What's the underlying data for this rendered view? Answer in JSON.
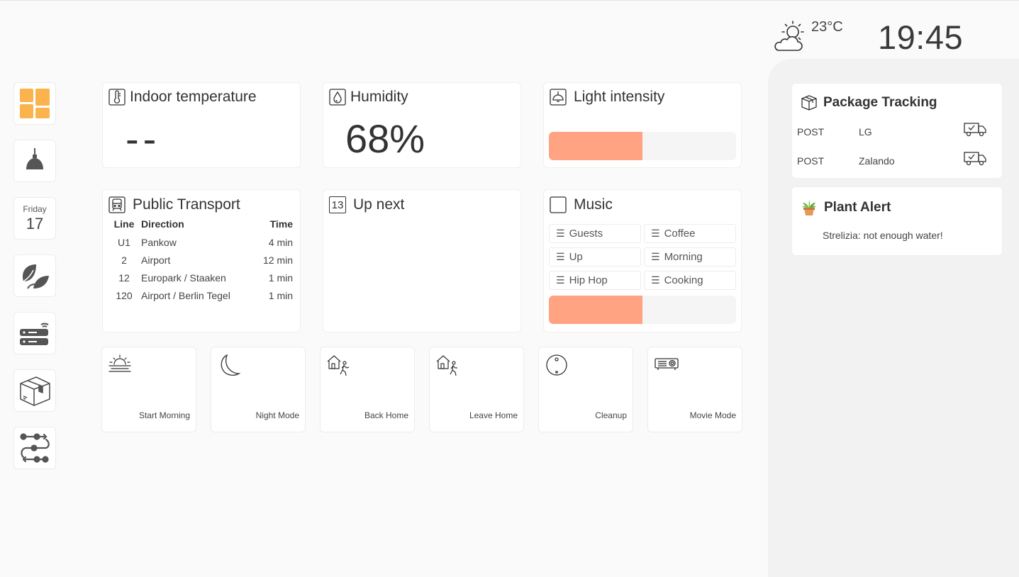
{
  "header": {
    "weather_icon": "sun-behind-cloud-icon",
    "temperature": "23°C",
    "time": "19:45"
  },
  "sidebar": {
    "items": [
      {
        "name": "dashboard",
        "icon": "dashboard-grid-icon",
        "active": true
      },
      {
        "name": "lights",
        "icon": "ceiling-lamp-icon"
      },
      {
        "name": "calendar",
        "day": "Friday",
        "date": "17"
      },
      {
        "name": "plants",
        "icon": "leaves-icon"
      },
      {
        "name": "network",
        "icon": "router-wifi-icon"
      },
      {
        "name": "packages",
        "icon": "package-box-icon"
      },
      {
        "name": "automations",
        "icon": "workflow-icon"
      }
    ]
  },
  "widgets": {
    "indoor_temperature": {
      "title": "Indoor temperature",
      "value": "--"
    },
    "humidity": {
      "title": "Humidity",
      "value": "68%"
    },
    "light_intensity": {
      "title": "Light intensity",
      "level": 0.5
    },
    "public_transport": {
      "title": "Public Transport",
      "columns": [
        "Line",
        "Direction",
        "Time"
      ],
      "rows": [
        {
          "line": "U1",
          "direction": "Pankow",
          "time": "4 min"
        },
        {
          "line": "2",
          "direction": "Airport",
          "time": "12 min"
        },
        {
          "line": "12",
          "direction": "Europark / Staaken",
          "time": "1 min"
        },
        {
          "line": "120",
          "direction": "Airport / Berlin Tegel",
          "time": "1 min"
        }
      ]
    },
    "up_next": {
      "title": "Up next",
      "icon_text": "13"
    },
    "music": {
      "title": "Music",
      "playlists": [
        "Guests",
        "Coffee",
        "Up",
        "Morning",
        "Hip Hop",
        "Cooking"
      ],
      "volume": 0.5
    }
  },
  "scenes": [
    {
      "label": "Start Morning",
      "icon": "sunrise-icon"
    },
    {
      "label": "Night Mode",
      "icon": "crescent-moon-icon"
    },
    {
      "label": "Back Home",
      "icon": "house-person-arriving-icon"
    },
    {
      "label": "Leave Home",
      "icon": "house-person-leaving-icon"
    },
    {
      "label": "Cleanup",
      "icon": "robot-vacuum-icon"
    },
    {
      "label": "Movie Mode",
      "icon": "projector-icon"
    }
  ],
  "package_tracking": {
    "title": "Package Tracking",
    "items": [
      {
        "carrier": "POST",
        "shop": "LG"
      },
      {
        "carrier": "POST",
        "shop": "Zalando"
      }
    ]
  },
  "plant_alert": {
    "title": "Plant Alert",
    "message": "Strelizia: not enough water!"
  },
  "colors": {
    "accent_orange": "#ffa382",
    "dashboard_icon": "#fbb34d",
    "background": "#fafafa",
    "panel": "#f2f2f2"
  }
}
